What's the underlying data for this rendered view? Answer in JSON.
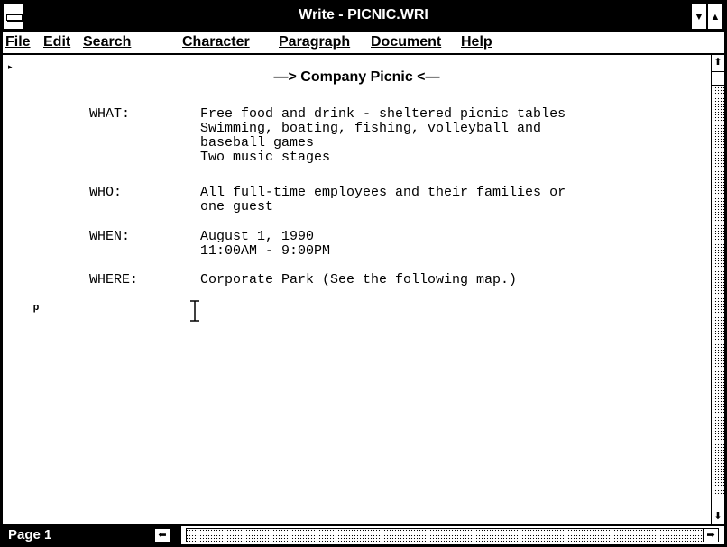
{
  "window": {
    "title": "Write - PICNIC.WRI",
    "min_glyph": "▼",
    "max_glyph": "▲"
  },
  "menu": {
    "items": [
      {
        "label": "File"
      },
      {
        "label": "Edit"
      },
      {
        "label": "Search"
      },
      {
        "label": "Character"
      },
      {
        "label": "Paragraph"
      },
      {
        "label": "Document"
      },
      {
        "label": "Help"
      }
    ]
  },
  "document": {
    "heading": "—> Company Picnic <—",
    "sections": [
      {
        "label": "WHAT:",
        "lines": [
          "Free food and drink - sheltered picnic tables",
          "Swimming, boating, fishing, volleyball and",
          "baseball games",
          "Two music stages"
        ]
      },
      {
        "label": "WHO:",
        "lines": [
          "All full-time employees and their families or",
          "one guest"
        ]
      },
      {
        "label": "WHEN:",
        "lines": [
          "August 1, 1990",
          "11:00AM - 9:00PM"
        ]
      },
      {
        "label": "WHERE:",
        "lines": [
          "Corporate Park (See the following map.)"
        ]
      }
    ],
    "end_mark": "ᵖ",
    "start_mark": "▸"
  },
  "scrollbars": {
    "up_arrow": "⬆",
    "down_arrow": "⬇",
    "left_arrow": "⬅",
    "right_arrow": "➡"
  },
  "status": {
    "page_label": "Page 1"
  }
}
